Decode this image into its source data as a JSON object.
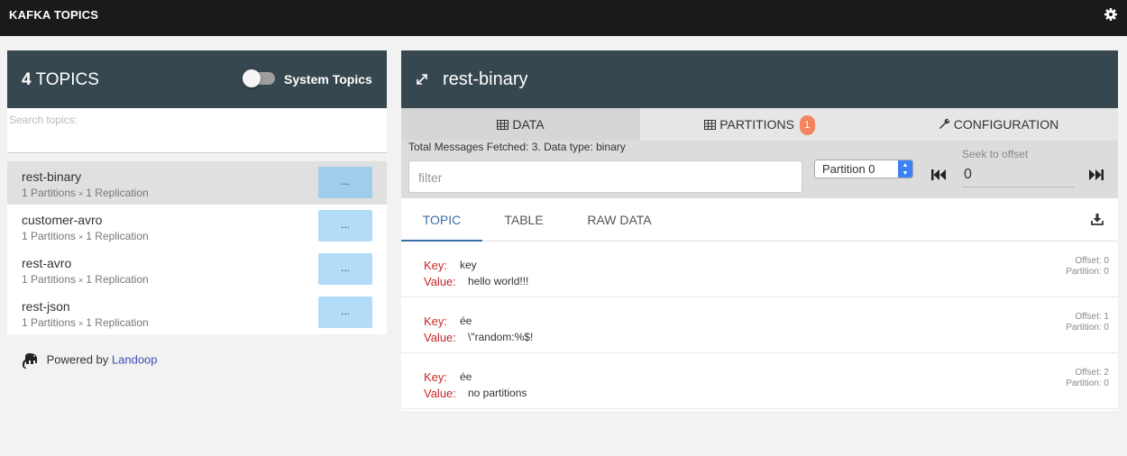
{
  "header": {
    "title": "KAFKA TOPICS",
    "settings_icon": "gear-icon"
  },
  "left_panel": {
    "topic_count": "4",
    "topic_count_label": "TOPICS",
    "system_topics_label": "System Topics",
    "system_topics_enabled": false,
    "search_label": "Search topics:",
    "topics": [
      {
        "name": "rest-binary",
        "partitions": "1 Partitions",
        "sep": "×",
        "replication": "1 Replication",
        "button": "...",
        "selected": true
      },
      {
        "name": "customer-avro",
        "partitions": "1 Partitions",
        "sep": "×",
        "replication": "1 Replication",
        "button": "...",
        "selected": false
      },
      {
        "name": "rest-avro",
        "partitions": "1 Partitions",
        "sep": "×",
        "replication": "1 Replication",
        "button": "...",
        "selected": false
      },
      {
        "name": "rest-json",
        "partitions": "1 Partitions",
        "sep": "×",
        "replication": "1 Replication",
        "button": "...",
        "selected": false
      }
    ],
    "powered_by": "Powered by",
    "powered_link": "Landoop"
  },
  "right_panel": {
    "topic_name": "rest-binary",
    "tabs": [
      {
        "label": "DATA",
        "icon": "table-icon"
      },
      {
        "label": "PARTITIONS",
        "icon": "table-icon",
        "badge": "1"
      },
      {
        "label": "CONFIGURATION",
        "icon": "wrench-icon"
      }
    ],
    "info": "Total Messages Fetched: 3. Data type: binary",
    "filter_placeholder": "filter",
    "partition_select": "Partition 0",
    "seek_label": "Seek to offset",
    "seek_value": "0",
    "subtabs": [
      "TOPIC",
      "TABLE",
      "RAW DATA"
    ],
    "key_label": "Key:",
    "value_label": "Value:",
    "messages": [
      {
        "key": "key",
        "value": "hello world!!!",
        "offset": "Offset: 0",
        "partition": "Partition: 0"
      },
      {
        "key": "ée",
        "value": "\\\"random:%$!",
        "offset": "Offset: 1",
        "partition": "Partition: 0"
      },
      {
        "key": "ée",
        "value": "no partitions",
        "offset": "Offset: 2",
        "partition": "Partition: 0"
      }
    ]
  },
  "colors": {
    "header_bg": "#1a1a1a",
    "panel_header": "#37474f",
    "button": "#b3dcf8",
    "key_label": "#c62828",
    "badge": "#f4845f",
    "active_subtab": "#3b6ea5"
  }
}
